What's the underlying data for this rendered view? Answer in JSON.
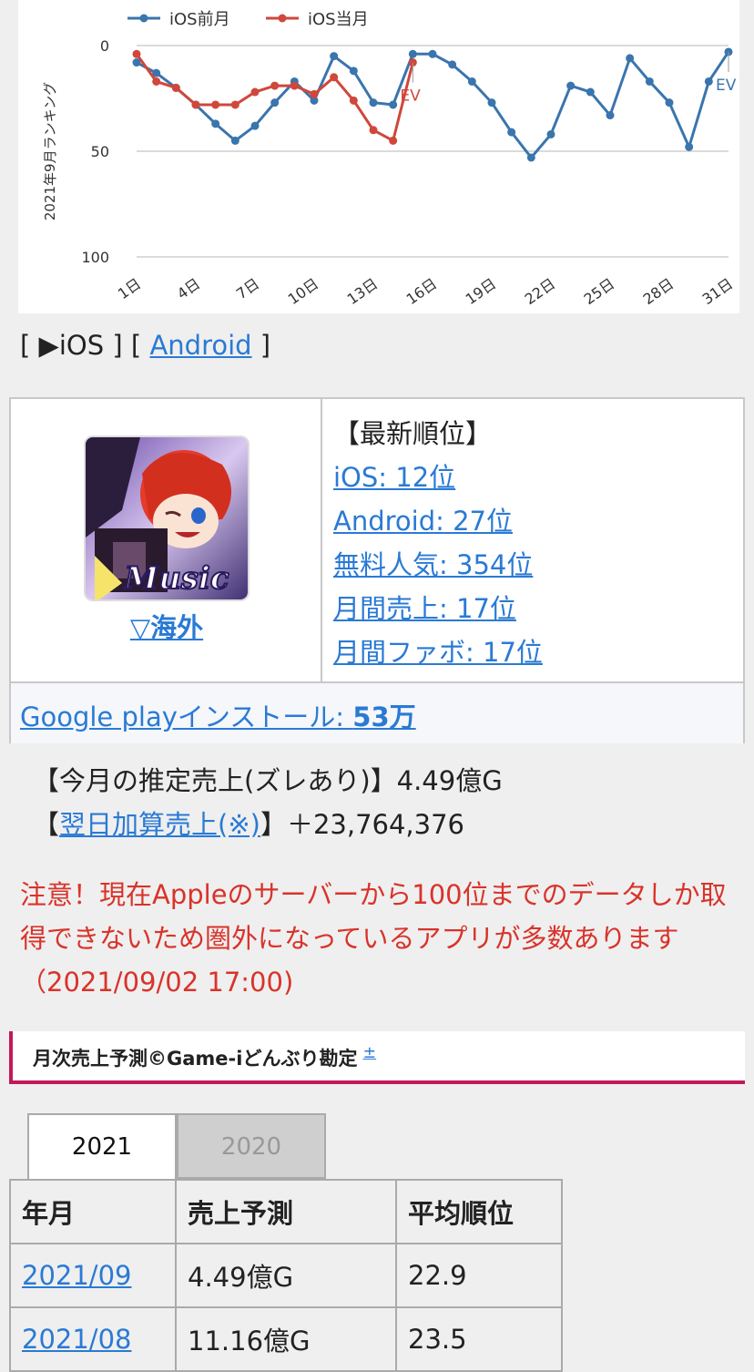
{
  "chart_data": {
    "type": "line",
    "ylabel": "2021年9月ランキング",
    "ylim": [
      100,
      0
    ],
    "yticks": [
      "0",
      "50",
      "100"
    ],
    "xtick_labels": [
      "1日",
      "4日",
      "7日",
      "10日",
      "13日",
      "16日",
      "19日",
      "22日",
      "25日",
      "28日",
      "31日"
    ],
    "xtick_days": [
      1,
      4,
      7,
      10,
      13,
      16,
      19,
      22,
      25,
      28,
      31
    ],
    "x": [
      1,
      2,
      3,
      4,
      5,
      6,
      7,
      8,
      9,
      10,
      11,
      12,
      13,
      14,
      15,
      16,
      17,
      18,
      19,
      20,
      21,
      22,
      23,
      24,
      25,
      26,
      27,
      28,
      29,
      30,
      31
    ],
    "series": [
      {
        "name": "iOS前月",
        "color": "#3a75ad",
        "values": [
          8,
          13,
          20,
          28,
          37,
          45,
          38,
          27,
          17,
          26,
          5,
          12,
          27,
          28,
          4,
          4,
          9,
          17,
          27,
          41,
          53,
          42,
          19,
          22,
          33,
          6,
          17,
          27,
          48,
          17,
          3
        ]
      },
      {
        "name": "iOS当月",
        "color": "#d0473b",
        "values": [
          4,
          17,
          20,
          28,
          28,
          28,
          22,
          19,
          19,
          23,
          15,
          26,
          40,
          45,
          8
        ]
      }
    ],
    "annotations": [
      {
        "label": "EV",
        "day": 15,
        "series": 1
      },
      {
        "label": "EV",
        "day": 31,
        "series": 0
      }
    ],
    "grid": "horizontal",
    "legend": "top-left"
  },
  "platform": {
    "open_bracket": "[",
    "ios_label": "▶iOS",
    "mid_bracket": "] [",
    "android_label": "Android",
    "close_bracket": "]"
  },
  "app_card": {
    "icon_text": "Music",
    "overseas_link": "▽海外",
    "rank_header": "【最新順位】",
    "ranks": [
      "iOS: 12位",
      "Android: 27位",
      "無料人気: 354位",
      "月間売上: 17位",
      "月間ファボ: 17位"
    ],
    "install_label": "Google playインストール: ",
    "install_count": "53万"
  },
  "estimates": {
    "monthly_label": "【今月の推定売上(ズレあり)】4.49億G",
    "next_open": "【",
    "next_link": "翌日加算売上(※)",
    "next_close": "】＋23,764,376"
  },
  "warning": "注意！現在Appleのサーバーから100位までのデータしか取得できないため圏外になっているアプリが多数あります（2021/09/02 17:00)",
  "section": {
    "title": "月次売上予測©Game-iどんぶり勘定",
    "toggle": "±"
  },
  "tabs": [
    "2021",
    "2020"
  ],
  "table": {
    "headers": [
      "年月",
      "売上予測",
      "平均順位"
    ],
    "rows": [
      [
        "2021/09",
        "4.49億G",
        "22.9"
      ],
      [
        "2021/08",
        "11.16億G",
        "23.5"
      ]
    ]
  }
}
